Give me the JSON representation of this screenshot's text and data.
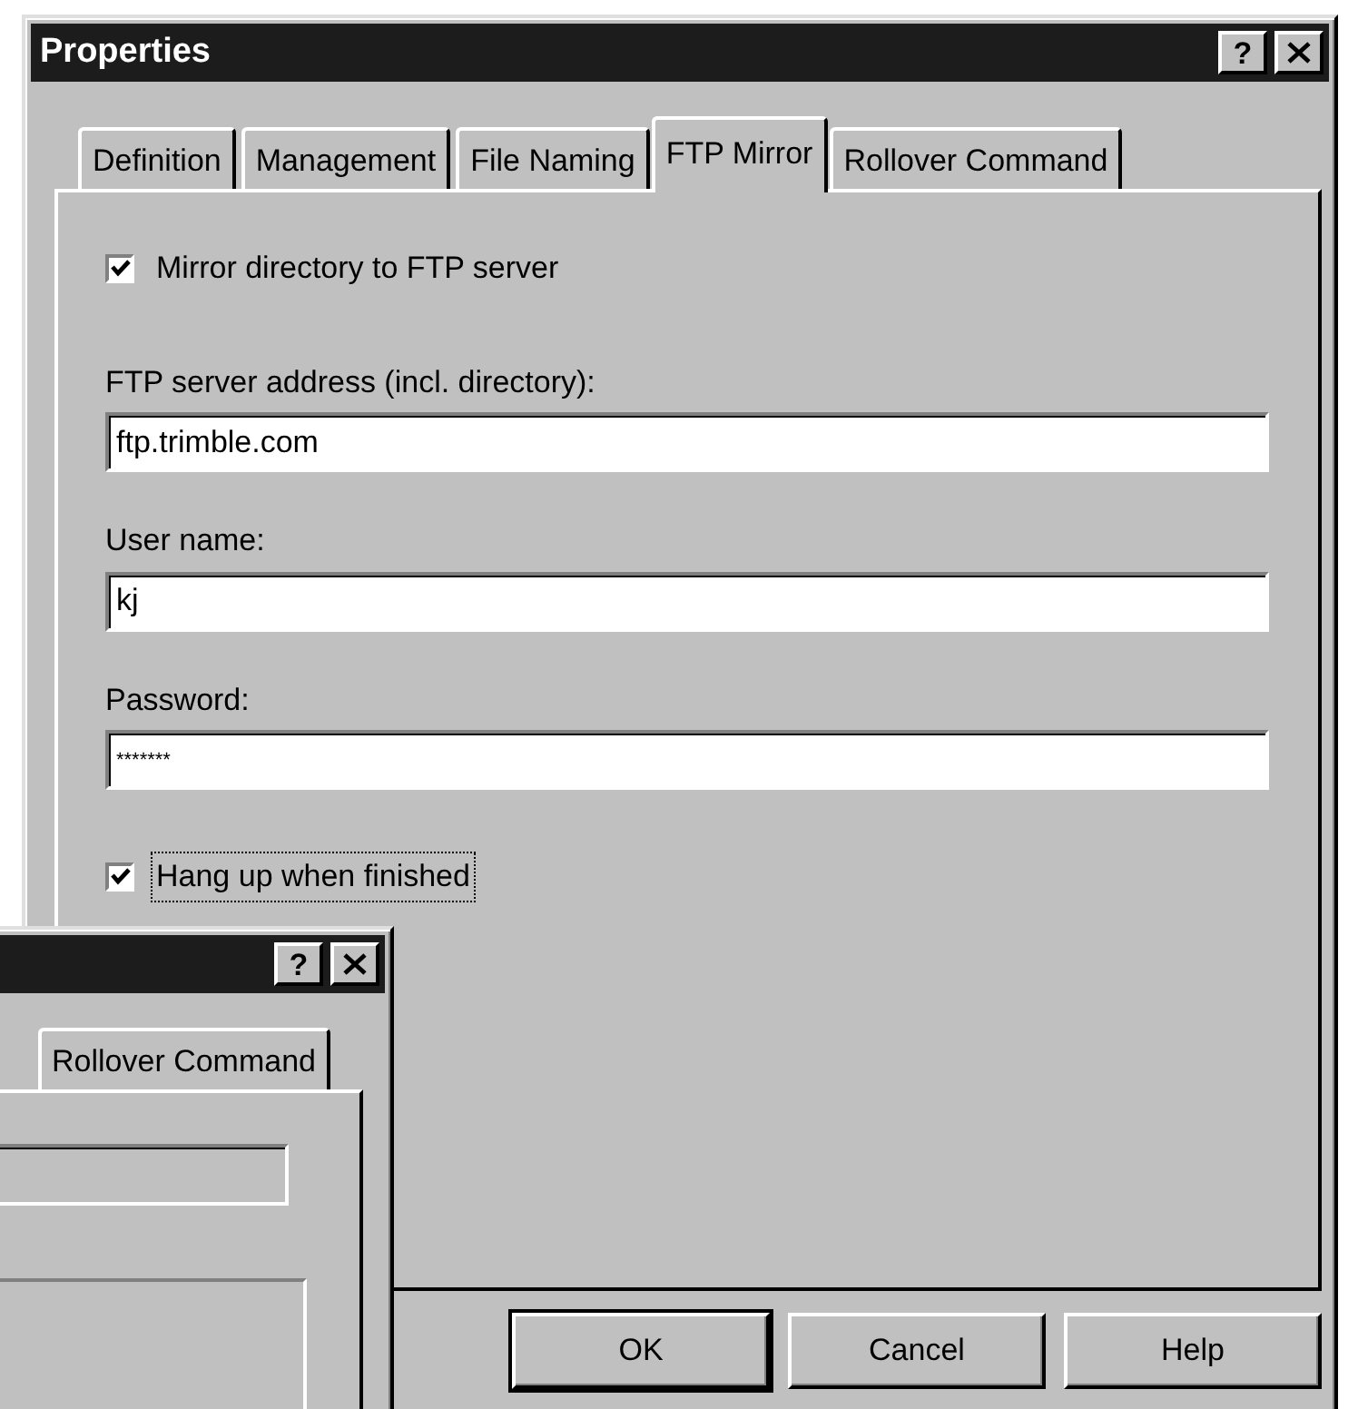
{
  "window": {
    "title": "Properties",
    "help_button": "?"
  },
  "tabs": [
    {
      "label": "Definition",
      "selected": false
    },
    {
      "label": "Management",
      "selected": false
    },
    {
      "label": "File Naming",
      "selected": false
    },
    {
      "label": "FTP Mirror",
      "selected": true
    },
    {
      "label": "Rollover Command",
      "selected": false
    }
  ],
  "mirror_checkbox": {
    "label": "Mirror directory to FTP server",
    "checked": true,
    "focused": false
  },
  "fields": [
    {
      "label": "FTP server address (incl. directory):",
      "value": "ftp.trimble.com"
    },
    {
      "label": "User name:",
      "value": "kj"
    },
    {
      "label": "Password:",
      "value": "*******"
    }
  ],
  "hangup_checkbox": {
    "label": "Hang up when finished",
    "checked": true,
    "focused": true
  },
  "buttons": [
    {
      "label": "OK",
      "default": true
    },
    {
      "label": "Cancel",
      "default": false
    },
    {
      "label": "Help",
      "default": false
    }
  ],
  "second_window": {
    "help_button": "?",
    "tabs": [
      {
        "label": "Rollover Command",
        "selected": false
      }
    ],
    "field": {
      "disabled": true
    }
  }
}
